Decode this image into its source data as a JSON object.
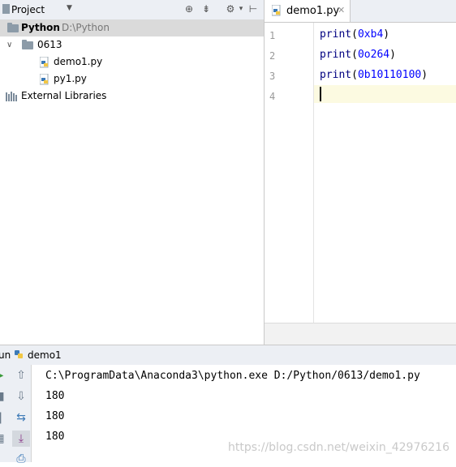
{
  "project_panel": {
    "title": "Project",
    "dropdown_icon": "caret-down",
    "tree": {
      "root": {
        "label": "Python",
        "path": "D:\\Python"
      },
      "folder": {
        "label": "0613"
      },
      "files": [
        {
          "label": "demo1.py"
        },
        {
          "label": "py1.py"
        }
      ],
      "external": {
        "label": "External Libraries"
      }
    }
  },
  "editor": {
    "tab": {
      "label": "demo1.py"
    },
    "line_numbers": [
      "1",
      "2",
      "3",
      "4"
    ],
    "lines": [
      {
        "func": "print",
        "open": "(",
        "arg": "0xb4",
        "close": ")"
      },
      {
        "func": "print",
        "open": "(",
        "arg": "0o264",
        "close": ")"
      },
      {
        "func": "print",
        "open": "(",
        "arg": "0b10110100",
        "close": ")"
      }
    ]
  },
  "run_panel": {
    "title": "un",
    "config": "demo1",
    "output": [
      "C:\\ProgramData\\Anaconda3\\python.exe D:/Python/0613/demo1.py",
      "180",
      "180",
      "180"
    ],
    "watermark": "https://blog.csdn.net/weixin_42976216"
  },
  "colors": {
    "keyword": "#000080",
    "number": "#0000ff",
    "current_line": "#fcfae1",
    "selection": "#dadada"
  }
}
